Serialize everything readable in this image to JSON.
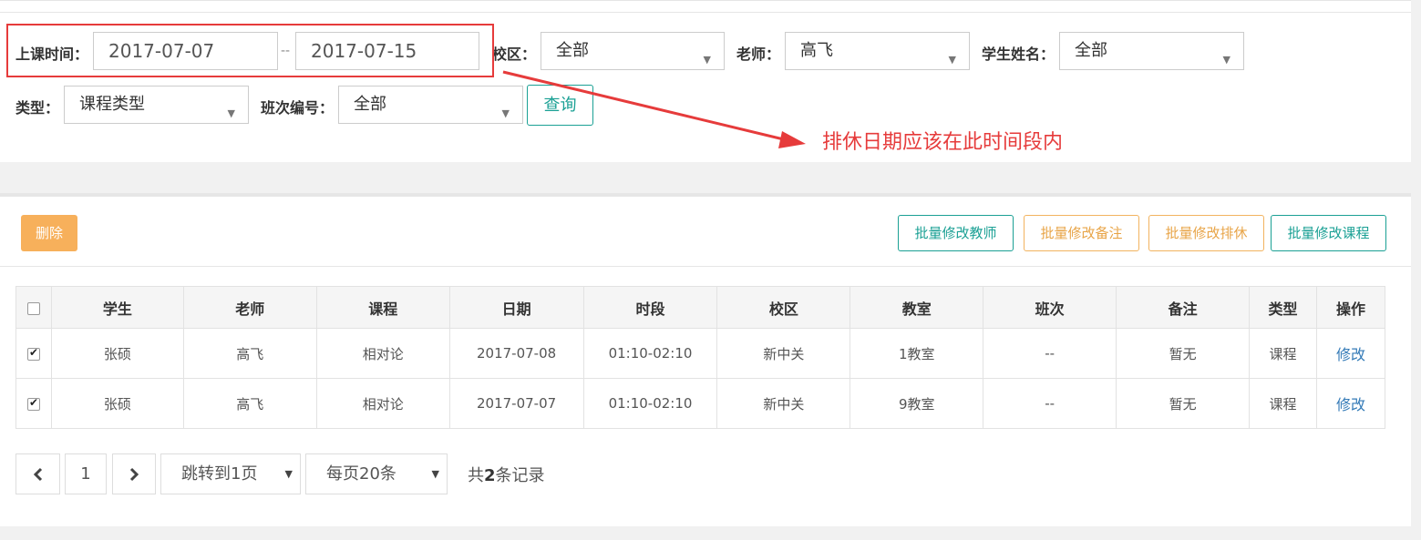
{
  "filters": {
    "time_label": "上课时间：",
    "start_date": "2017-07-07",
    "separator": "--",
    "end_date": "2017-07-15",
    "campus_label": "校区：",
    "campus_value": "全部",
    "teacher_label": "老师：",
    "teacher_value": "高飞",
    "student_label": "学生姓名：",
    "student_value": "全部",
    "type_label": "类型：",
    "type_value": "课程类型",
    "class_label": "班次编号：",
    "class_value": "全部",
    "query_label": "查询"
  },
  "annotation": {
    "text": "排休日期应该在此时间段内",
    "color": "#e63b3b"
  },
  "toolbar": {
    "delete_label": "删除",
    "batch_teacher": "批量修改教师",
    "batch_remark": "批量修改备注",
    "batch_rest": "批量修改排休",
    "batch_course": "批量修改课程"
  },
  "table": {
    "headers": [
      "学生",
      "老师",
      "课程",
      "日期",
      "时段",
      "校区",
      "教室",
      "班次",
      "备注",
      "类型",
      "操作"
    ],
    "rows": [
      {
        "student": "张硕",
        "teacher": "高飞",
        "course": "相对论",
        "date": "2017-07-08",
        "time": "01:10-02:10",
        "campus": "新中关",
        "room": "1教室",
        "class": "--",
        "remark": "暂无",
        "type": "课程",
        "action": "修改",
        "checked": true
      },
      {
        "student": "张硕",
        "teacher": "高飞",
        "course": "相对论",
        "date": "2017-07-07",
        "time": "01:10-02:10",
        "campus": "新中关",
        "room": "9教室",
        "class": "--",
        "remark": "暂无",
        "type": "课程",
        "action": "修改",
        "checked": true
      }
    ]
  },
  "pagination": {
    "current_page": "1",
    "jump_label": "跳转到1页",
    "page_size_label": "每页20条",
    "total_prefix": "共",
    "total_count": "2",
    "total_suffix": "条记录"
  },
  "colors": {
    "accent_teal": "#1aa094",
    "accent_orange": "#f7b05b",
    "link_blue": "#337ab7"
  }
}
